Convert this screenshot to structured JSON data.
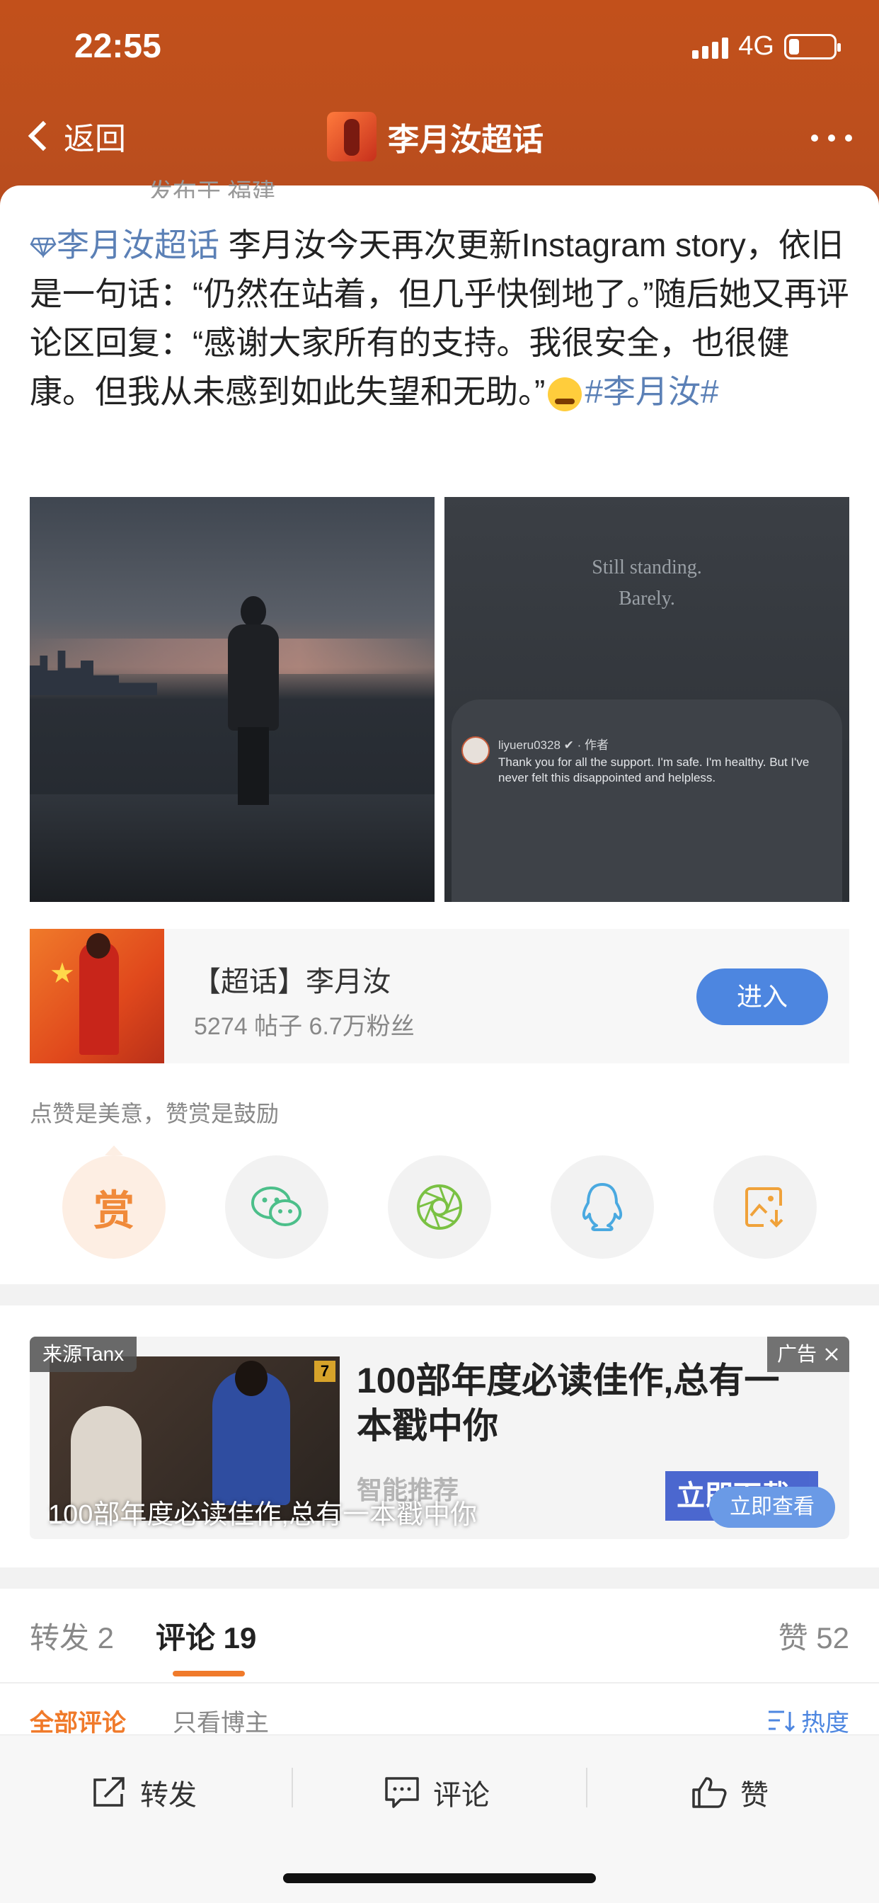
{
  "status": {
    "time": "22:55",
    "network": "4G"
  },
  "nav": {
    "back_label": "返回",
    "title": "李月汝超话"
  },
  "post": {
    "cut_text": "发布于 福建",
    "topic_link": "李月汝超话",
    "body": " 李月汝今天再次更新Instagram story，依旧是一句话：“仍然在站着，但几乎快倒地了。”随后她又再评论区回复：“感谢大家所有的支持。我很安全，也很健康。但我从未感到如此失望和无助。”",
    "hashtag": "#李月汝#",
    "image2": {
      "story_line1": "Still standing.",
      "story_line2": "Barely.",
      "comment_user": "liyueru0328 ✔ · 作者",
      "comment_text": "Thank you for all the support. I'm safe. I'm healthy. But I've never felt this disappointed and helpless."
    }
  },
  "topic_card": {
    "title": "【超话】李月汝",
    "stats": "5274 帖子 6.7万粉丝",
    "enter_label": "进入"
  },
  "reward": {
    "hint": "点赞是美意，赞赏是鼓励",
    "reward_char": "赏",
    "share_icons": [
      "reward-icon",
      "wechat-icon",
      "moments-icon",
      "qq-icon",
      "save-image-icon"
    ]
  },
  "ad": {
    "source": "来源Tanx",
    "label": "广告",
    "title": "100部年度必读佳作,总有一本戳中你",
    "subtitle": "智能推荐",
    "cta_back": "立即下载",
    "overlay_text": "100部年度必读佳作,总有一本戳中你",
    "view_label": "立即查看",
    "badge": "7"
  },
  "tabs": {
    "repost": "转发 2",
    "comments": "评论 19",
    "likes": "赞 52"
  },
  "filters": {
    "all": "全部评论",
    "author_only": "只看博主",
    "sort": "热度"
  },
  "bottom_bar": {
    "repost": "转发",
    "comment": "评论",
    "like": "赞"
  },
  "colors": {
    "header_bg": "#bd4f1d",
    "link": "#5b80b6",
    "accent_orange": "#f07a2a",
    "enter_button": "#4d86e0"
  }
}
